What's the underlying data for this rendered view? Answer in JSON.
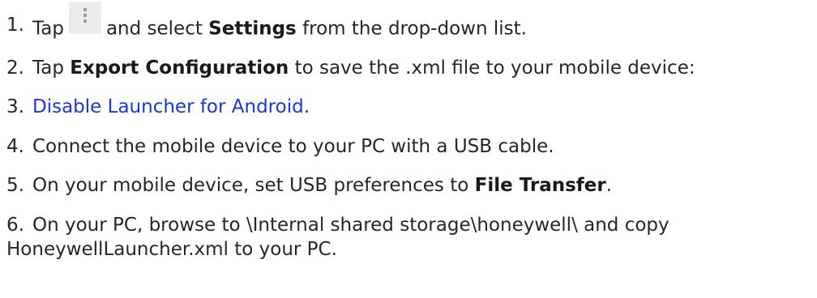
{
  "steps": [
    {
      "number": "1.",
      "pre": "Tap",
      "bold": "Settings",
      "text_a": "and select",
      "text_b": "from the drop-down list."
    },
    {
      "number": "2.",
      "pre": "Tap",
      "bold": "Export Configuration",
      "text_b": "to save the .xml file to your mobile device:"
    },
    {
      "number": "3.",
      "link": "Disable Launcher for Android",
      "text_b": "."
    },
    {
      "number": "4.",
      "text": "Connect the mobile device to your PC with a USB cable."
    },
    {
      "number": "5.",
      "text": "On your mobile device, set USB preferences to",
      "bold": "File Transfer",
      "text_b": "."
    },
    {
      "number": "6.",
      "text": "On your PC, browse to \\Internal shared storage\\honeywell\\ and copy",
      "cont": "HoneywellLauncher.xml to your PC."
    }
  ],
  "icons": {
    "menu": "more-vert-icon"
  },
  "colors": {
    "text": "#262626",
    "link": "#1a35e0",
    "icon_bg": "#ececec",
    "icon_dot": "#9e9e9e"
  }
}
